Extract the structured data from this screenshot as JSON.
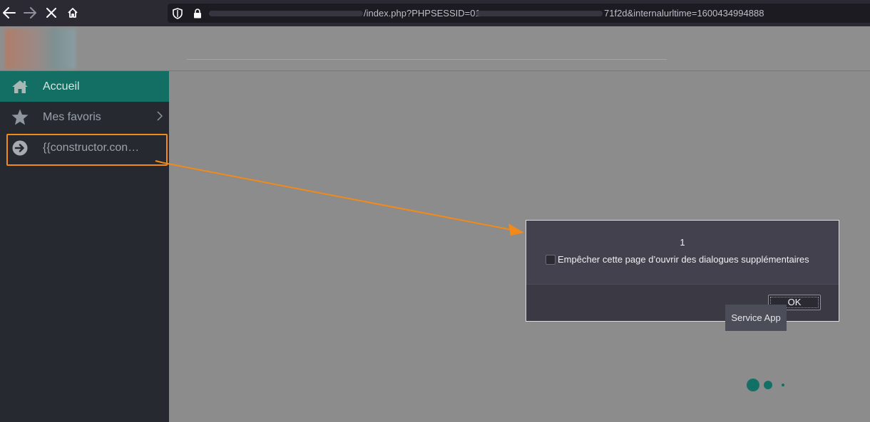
{
  "browser": {
    "url_part_1": "/index.php?PHPSESSID=01",
    "url_part_2": "71f2d&internalurltime=1600434994888",
    "icons": {
      "back": "arrow-left-icon",
      "forward": "arrow-right-icon",
      "stop": "close-icon",
      "home": "home-icon",
      "shield": "shield-icon",
      "lock": "lock-icon"
    }
  },
  "sidebar": {
    "items": [
      {
        "label": "Accueil",
        "icon": "home-icon",
        "active": true
      },
      {
        "label": "Mes favoris",
        "icon": "star-icon",
        "has_submenu": true
      },
      {
        "label": "{{constructor.con…",
        "icon": "arrow-circle-right-icon",
        "highlighted": true
      }
    ]
  },
  "dialog": {
    "message": "1",
    "checkbox_label": "Empêcher cette page d’ouvrir des dialogues supplémentaires",
    "checkbox_checked": false,
    "ok_label": "OK"
  },
  "tooltip": {
    "text": "Service App"
  },
  "colors": {
    "accent": "#136f63",
    "annotation": "#f28a1a",
    "sidebar_bg": "#262a30"
  }
}
